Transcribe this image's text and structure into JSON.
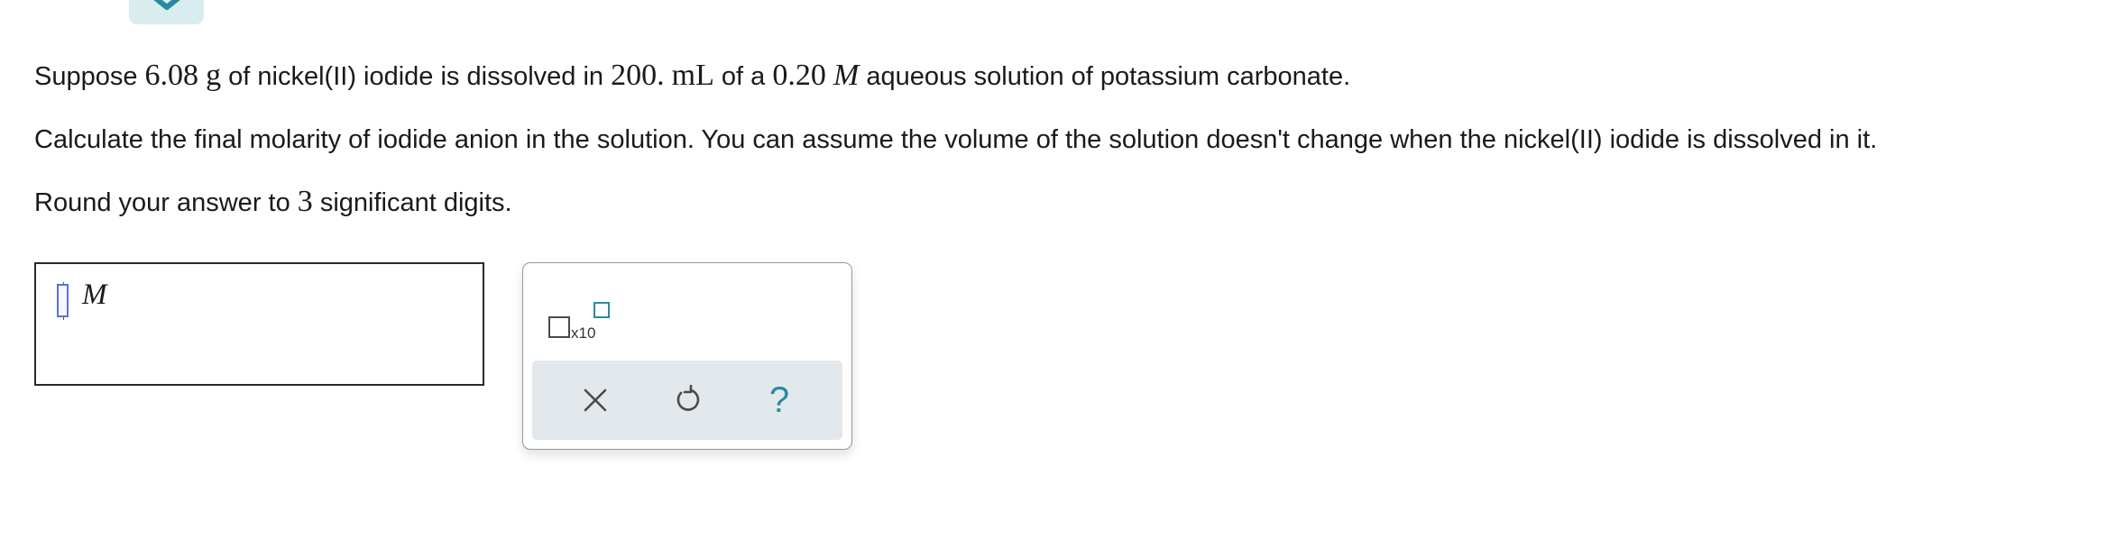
{
  "question": {
    "line1": {
      "t1": "Suppose ",
      "mass_value": "6.08",
      "t2": " ",
      "mass_unit": "g",
      "t3": " of nickel(II) iodide is dissolved in ",
      "volume_value": "200.",
      "t4": " ",
      "volume_unit": "mL",
      "t5": " of a ",
      "conc_value": "0.20",
      "t6": " ",
      "conc_unit": "M",
      "t7": " aqueous solution of potassium carbonate."
    },
    "line2": "Calculate the final molarity of iodide anion in the solution. You can assume the volume of the solution doesn't change when the nickel(II) iodide is dissolved in it.",
    "line3": {
      "t1": "Round your answer to ",
      "digits": "3",
      "t2": " significant digits."
    }
  },
  "answer": {
    "value": "",
    "unit": "M"
  },
  "toolbar": {
    "x10_label": "x10",
    "help_label": "?"
  },
  "icons": {
    "top_tab": "chevron-down-icon",
    "clear": "close-icon",
    "undo": "undo-icon",
    "help": "help-icon",
    "exponent": "exponent-box-icon"
  },
  "colors": {
    "accent": "#2a8aa0",
    "tab_bg": "#d9ecf0",
    "action_bar_bg": "#e3e8ec",
    "cursor": "#5b6fe0"
  }
}
